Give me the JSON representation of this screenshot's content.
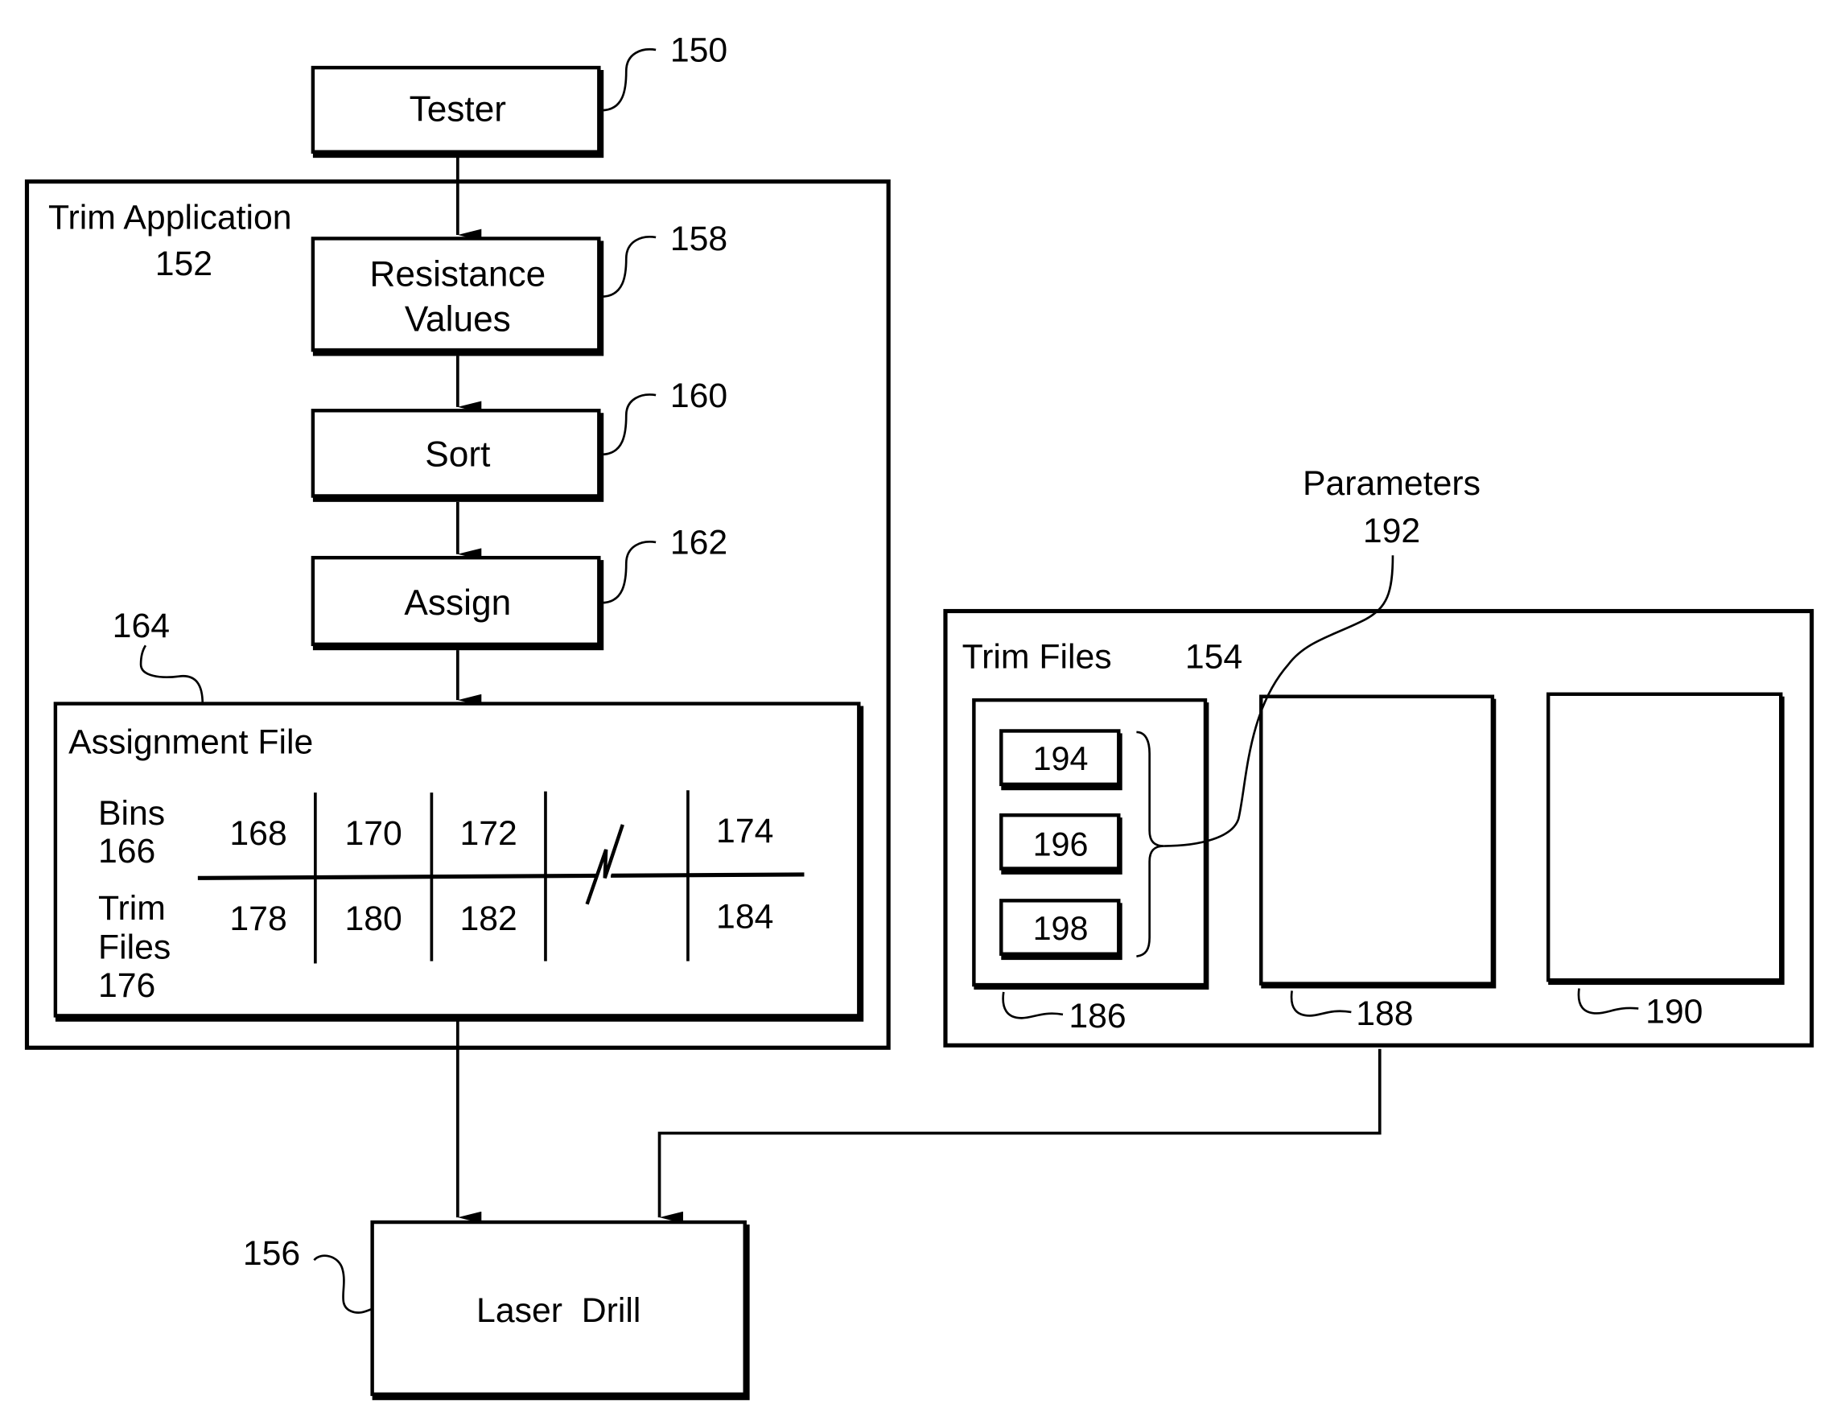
{
  "colors": {
    "ink": "#000000",
    "paper": "#ffffff"
  },
  "nodes": {
    "tester": {
      "label": "Tester",
      "ref": "150"
    },
    "trim_app": {
      "label": "Trim Application",
      "ref": "152"
    },
    "resistance": {
      "label_line1": "Resistance",
      "label_line2": "Values",
      "ref": "158"
    },
    "sort": {
      "label": "Sort",
      "ref": "160"
    },
    "assign": {
      "label": "Assign",
      "ref": "162"
    },
    "assignment_file": {
      "label": "Assignment File",
      "ref": "164",
      "row_headers": {
        "bins_label": "Bins",
        "bins_ref": "166",
        "trim_label1": "Trim",
        "trim_label2": "Files",
        "trim_ref": "176"
      },
      "bins": [
        "168",
        "170",
        "172",
        "174"
      ],
      "trim_files": [
        "178",
        "180",
        "182",
        "184"
      ]
    },
    "trim_files": {
      "label": "Trim Files",
      "ref": "154",
      "files": [
        "186",
        "188",
        "190"
      ],
      "parameters": [
        "194",
        "196",
        "198"
      ]
    },
    "parameters": {
      "label": "Parameters",
      "ref": "192"
    },
    "laser_drill": {
      "label": "Laser  Drill",
      "ref": "156"
    }
  },
  "edges": [
    {
      "from": "Tester",
      "to": "Resistance Values"
    },
    {
      "from": "Resistance Values",
      "to": "Sort"
    },
    {
      "from": "Sort",
      "to": "Assign"
    },
    {
      "from": "Assign",
      "to": "Assignment File"
    },
    {
      "from": "Trim Application",
      "to": "Laser Drill"
    },
    {
      "from": "Trim Files",
      "to": "Laser Drill"
    }
  ]
}
